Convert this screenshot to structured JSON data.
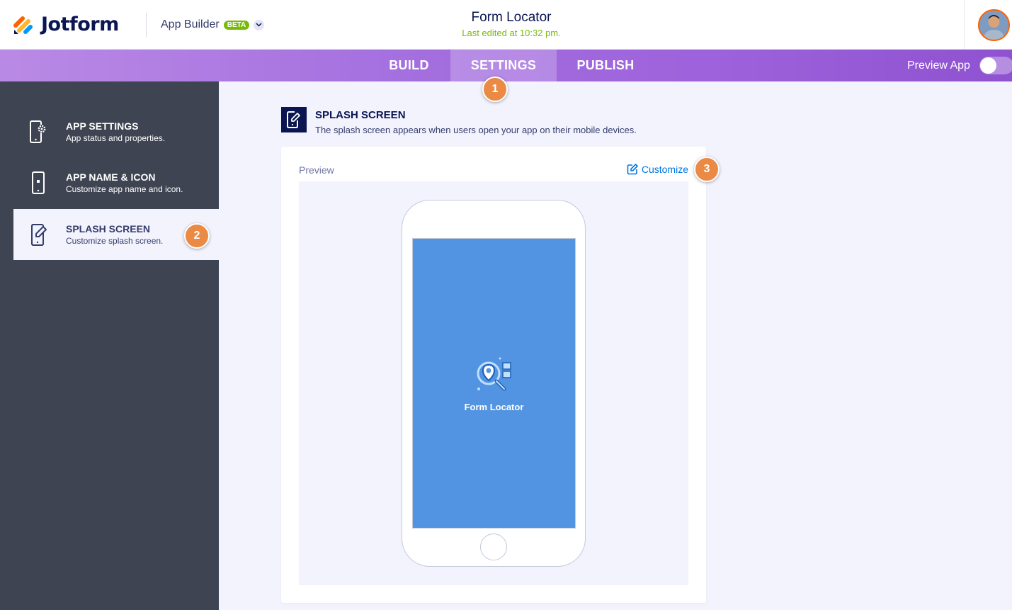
{
  "header": {
    "logo_text": "Jotform",
    "app_builder_label": "App Builder",
    "beta_label": "BETA",
    "form_title": "Form Locator",
    "last_edited": "Last edited at 10:32 pm."
  },
  "nav": {
    "tabs": [
      {
        "label": "BUILD",
        "active": false
      },
      {
        "label": "SETTINGS",
        "active": true
      },
      {
        "label": "PUBLISH",
        "active": false
      }
    ],
    "preview_app_label": "Preview App",
    "preview_toggle_on": false
  },
  "badges": [
    "1",
    "2",
    "3"
  ],
  "sidebar": {
    "items": [
      {
        "title": "APP SETTINGS",
        "subtitle": "App status and properties.",
        "icon": "phone-gear-icon",
        "active": false
      },
      {
        "title": "APP NAME & ICON",
        "subtitle": "Customize app name and icon.",
        "icon": "phone-icon",
        "active": false
      },
      {
        "title": "SPLASH SCREEN",
        "subtitle": "Customize splash screen.",
        "icon": "phone-edit-icon",
        "active": true
      }
    ]
  },
  "main": {
    "section_title": "SPLASH SCREEN",
    "section_subtitle": "The splash screen appears when users open your app on their mobile devices.",
    "preview_label": "Preview",
    "customize_label": "Customize",
    "splash_app_name": "Form Locator",
    "splash_bg_color": "#5294e2"
  },
  "colors": {
    "accent": "#0075e3",
    "navy": "#0a1551",
    "badge": "#ea8a45",
    "sidebar_bg": "#3e4452",
    "green": "#78bb07"
  }
}
